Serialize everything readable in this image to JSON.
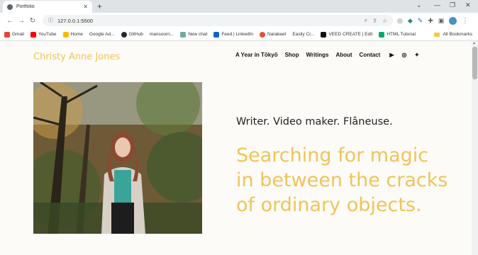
{
  "browser": {
    "tab_title": "Portfolio",
    "url": "127.0.0.1:5500",
    "bookmarks": [
      {
        "label": "Gmail",
        "color": "#ea4335"
      },
      {
        "label": "YouTube",
        "color": "#ff0000"
      },
      {
        "label": "Home",
        "color": "#fbbc04"
      },
      {
        "label": "Google Ad...",
        "color": "#4285f4"
      },
      {
        "label": "GitHub",
        "color": "#24292e"
      },
      {
        "label": "mansoorn...",
        "color": "#24292e"
      },
      {
        "label": "New chat",
        "color": "#74aa9c"
      },
      {
        "label": "Feed | LinkedIn",
        "color": "#0a66c2"
      },
      {
        "label": "Narakeet",
        "color": "#e94e3c"
      },
      {
        "label": "Easily Cr...",
        "color": "#888888"
      },
      {
        "label": "VEED CREATE | Edit",
        "color": "#111111"
      },
      {
        "label": "HTML Tutorial",
        "color": "#04aa6d"
      }
    ],
    "all_bookmarks": "All Bookmarks"
  },
  "page": {
    "brand": "Christy Anne Jones",
    "nav": [
      "A Year in Tōkyō",
      "Shop",
      "Writings",
      "About",
      "Contact"
    ],
    "social": [
      "youtube-icon",
      "instagram-icon",
      "twitter-icon"
    ],
    "tagline": "Writer. Video maker. Flâneuse.",
    "headline": "Searching for magic in between the cracks of ordinary objects.",
    "accent_color": "#f0c45a"
  }
}
